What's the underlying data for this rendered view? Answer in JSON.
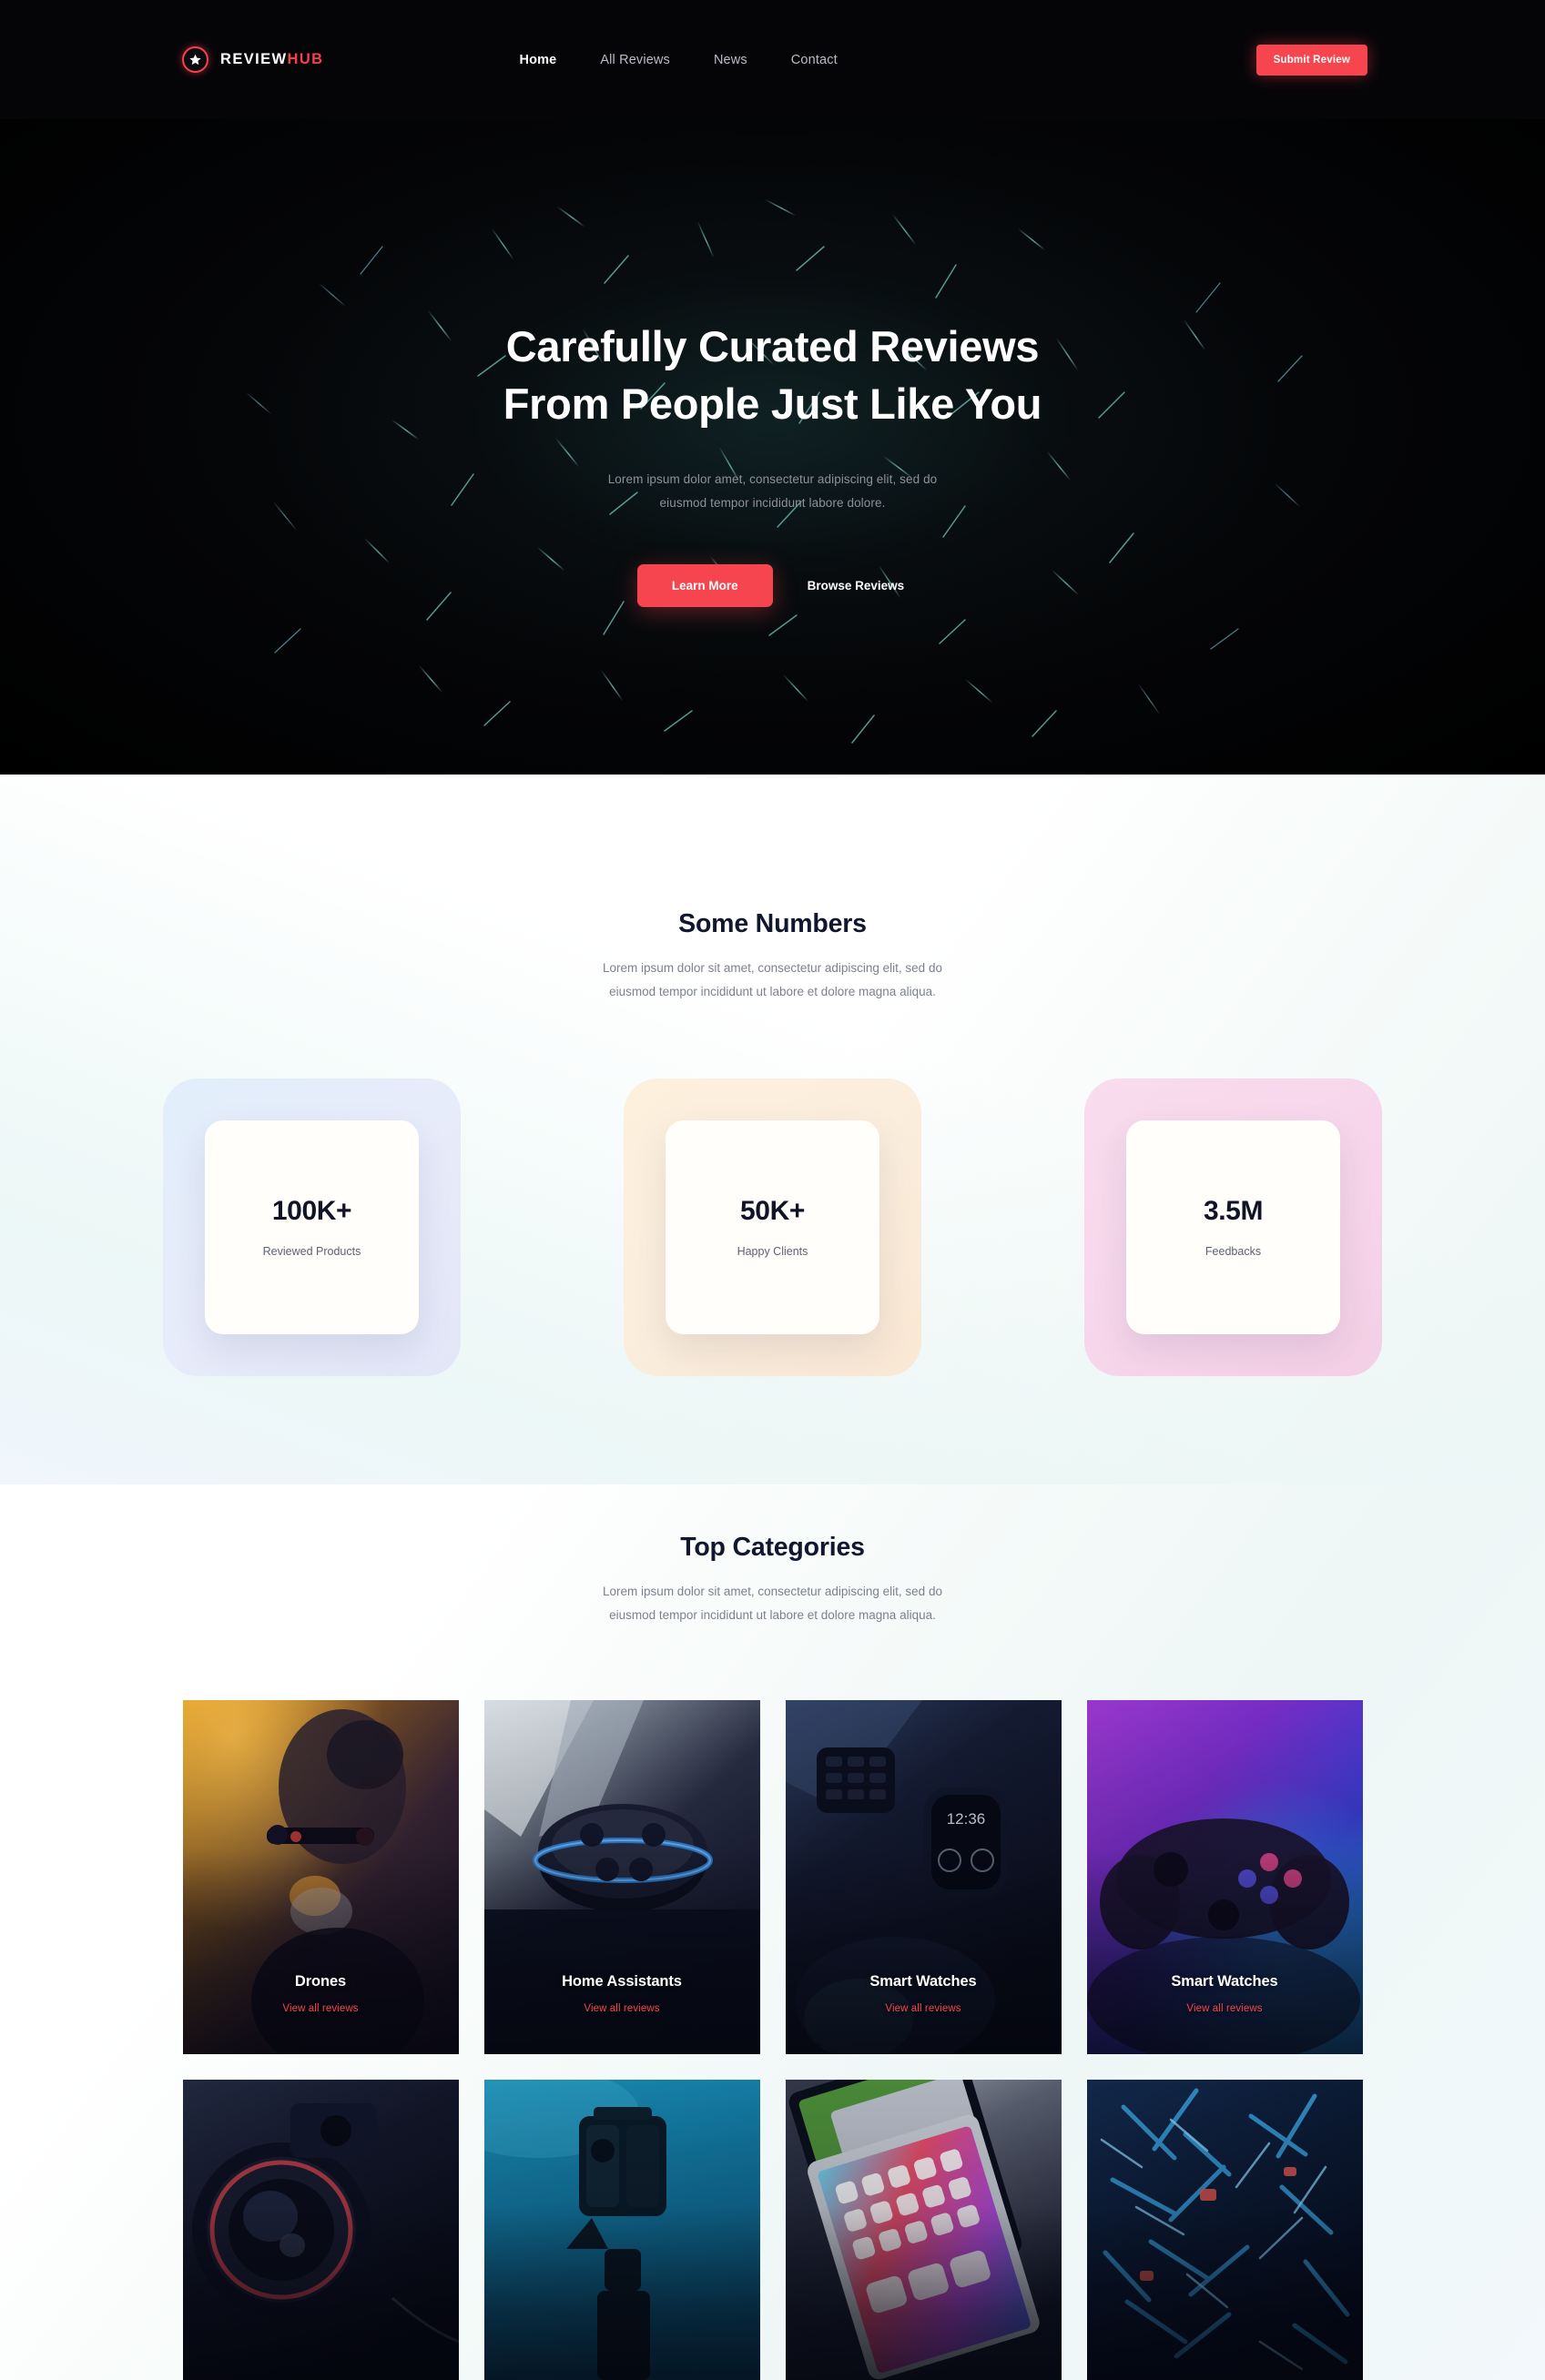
{
  "brand": {
    "word1": "REVIEW",
    "word2": "HUB",
    "icon": "star-in-circle-icon"
  },
  "nav": {
    "items": [
      {
        "label": "Home",
        "active": true
      },
      {
        "label": "All Reviews",
        "active": false
      },
      {
        "label": "News",
        "active": false
      },
      {
        "label": "Contact",
        "active": false
      }
    ],
    "cta_label": "Submit Review"
  },
  "hero": {
    "title_line1": "Carefully Curated Reviews",
    "title_line2": "From People Just Like You",
    "sub_line1": "Lorem ipsum dolor amet, consectetur adipiscing elit, sed do",
    "sub_line2": "eiusmod tempor incididunt labore dolore.",
    "primary_label": "Learn More",
    "secondary_label": "Browse Reviews"
  },
  "stats": {
    "title": "Some Numbers",
    "desc_line1": "Lorem ipsum dolor sit amet, consectetur adipiscing elit, sed do",
    "desc_line2": "eiusmod tempor incididunt ut labore et dolore magna aliqua.",
    "items": [
      {
        "value": "100K+",
        "label": "Reviewed Products",
        "tint": "blue"
      },
      {
        "value": "50K+",
        "label": "Happy Clients",
        "tint": "amber"
      },
      {
        "value": "3.5M",
        "label": "Feedbacks",
        "tint": "pink"
      }
    ]
  },
  "categories": {
    "title": "Top Categories",
    "desc_line1": "Lorem ipsum dolor sit amet, consectetur adipiscing elit, sed do",
    "desc_line2": "eiusmod tempor incididunt ut labore et dolore magna aliqua.",
    "link_label": "View all reviews",
    "row1": [
      {
        "name": "Drones",
        "image": "drone-at-dusk-photo"
      },
      {
        "name": "Home Assistants",
        "image": "smart-speaker-photo"
      },
      {
        "name": "Smart Watches",
        "image": "smartwatch-dark-photo"
      },
      {
        "name": "Smart Watches",
        "image": "game-controller-neon-photo"
      }
    ],
    "row2": [
      {
        "image": "dslr-camera-lens-photo"
      },
      {
        "image": "action-camera-underwater-photo"
      },
      {
        "image": "tablet-homescreen-photo"
      },
      {
        "image": "abstract-blue-tech-photo"
      }
    ]
  },
  "colors": {
    "accent": "#f7454f",
    "header_bg": "#050508",
    "hero_bg": "#030305",
    "heading": "#10172e",
    "muted_text": "#7d818d"
  }
}
